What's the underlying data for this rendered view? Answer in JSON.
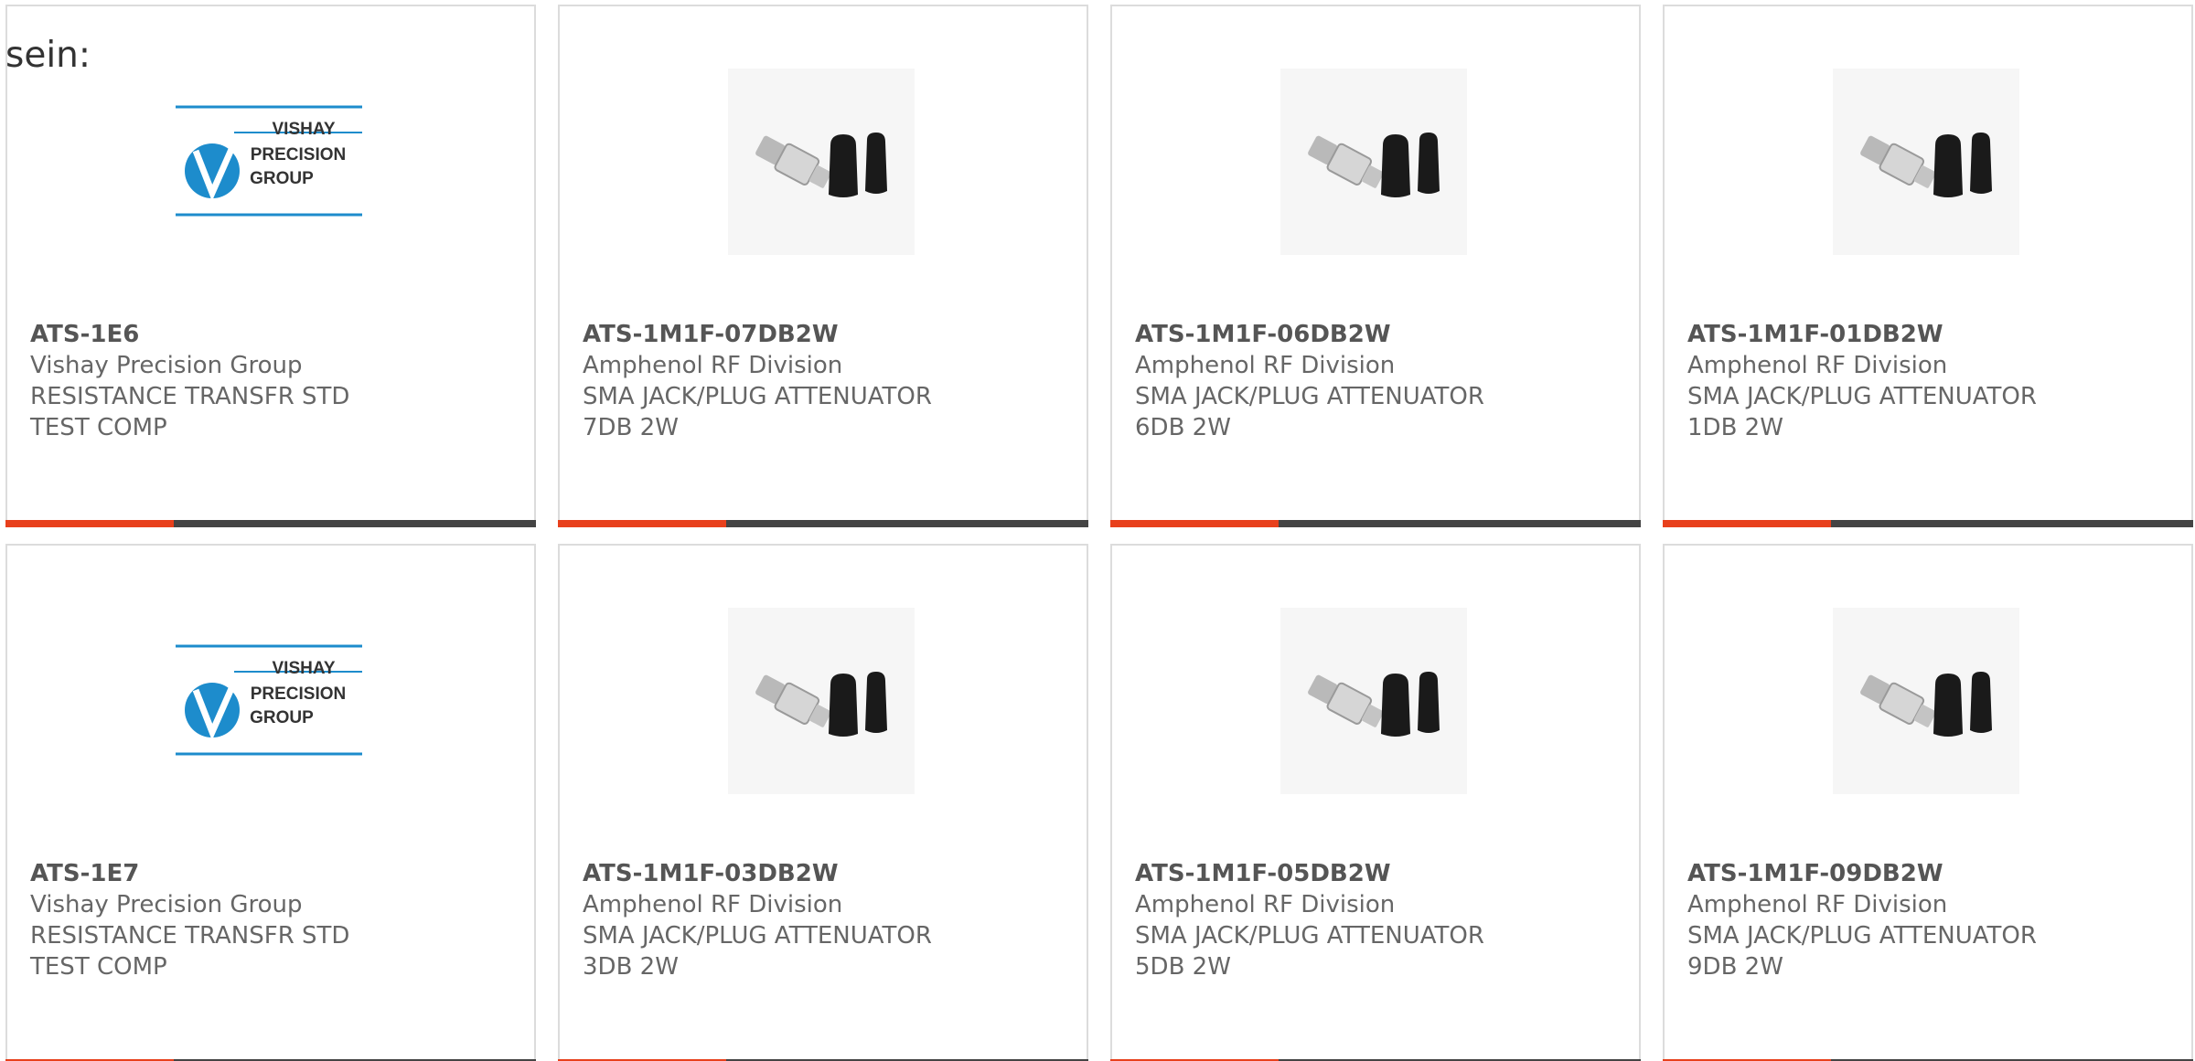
{
  "intro_text": "sein:",
  "colors": {
    "accent": "#e8401c",
    "bar_dark": "#444444",
    "border": "#dcdcdc",
    "text": "#666666",
    "vishay_blue": "#1d8ccc"
  },
  "products": [
    {
      "part_number": "ATS-1E6",
      "manufacturer": "Vishay Precision Group",
      "description": "RESISTANCE TRANSFR STD TEST COMP",
      "image": "vishay-logo",
      "logo_lines": [
        "VISHAY",
        "PRECISION",
        "GROUP"
      ]
    },
    {
      "part_number": "ATS-1M1F-07DB2W",
      "manufacturer": "Amphenol RF Division",
      "description": "SMA JACK/PLUG ATTENUATOR 7DB 2W",
      "image": "sma-attenuator-photo"
    },
    {
      "part_number": "ATS-1M1F-06DB2W",
      "manufacturer": "Amphenol RF Division",
      "description": "SMA JACK/PLUG ATTENUATOR 6DB 2W",
      "image": "sma-attenuator-photo"
    },
    {
      "part_number": "ATS-1M1F-01DB2W",
      "manufacturer": "Amphenol RF Division",
      "description": "SMA JACK/PLUG ATTENUATOR 1DB 2W",
      "image": "sma-attenuator-photo"
    },
    {
      "part_number": "ATS-1E7",
      "manufacturer": "Vishay Precision Group",
      "description": "RESISTANCE TRANSFR STD TEST COMP",
      "image": "vishay-logo",
      "logo_lines": [
        "VISHAY",
        "PRECISION",
        "GROUP"
      ]
    },
    {
      "part_number": "ATS-1M1F-03DB2W",
      "manufacturer": "Amphenol RF Division",
      "description": "SMA JACK/PLUG ATTENUATOR 3DB 2W",
      "image": "sma-attenuator-photo"
    },
    {
      "part_number": "ATS-1M1F-05DB2W",
      "manufacturer": "Amphenol RF Division",
      "description": "SMA JACK/PLUG ATTENUATOR 5DB 2W",
      "image": "sma-attenuator-photo"
    },
    {
      "part_number": "ATS-1M1F-09DB2W",
      "manufacturer": "Amphenol RF Division",
      "description": "SMA JACK/PLUG ATTENUATOR 9DB 2W",
      "image": "sma-attenuator-photo"
    }
  ]
}
